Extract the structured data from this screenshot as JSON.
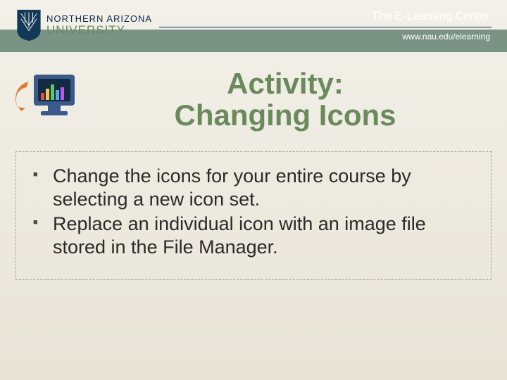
{
  "header": {
    "logo_line1": "NORTHERN ARIZONA",
    "logo_line2": "UNIVERSITY",
    "center_title": "The E-Learning Center",
    "url": "www.nau.edu/elearning"
  },
  "title_line1": "Activity:",
  "title_line2": "Changing Icons",
  "bullets": [
    "Change the icons for your entire course by selecting a new icon set.",
    "Replace an individual icon with an image file stored in the File Manager."
  ]
}
